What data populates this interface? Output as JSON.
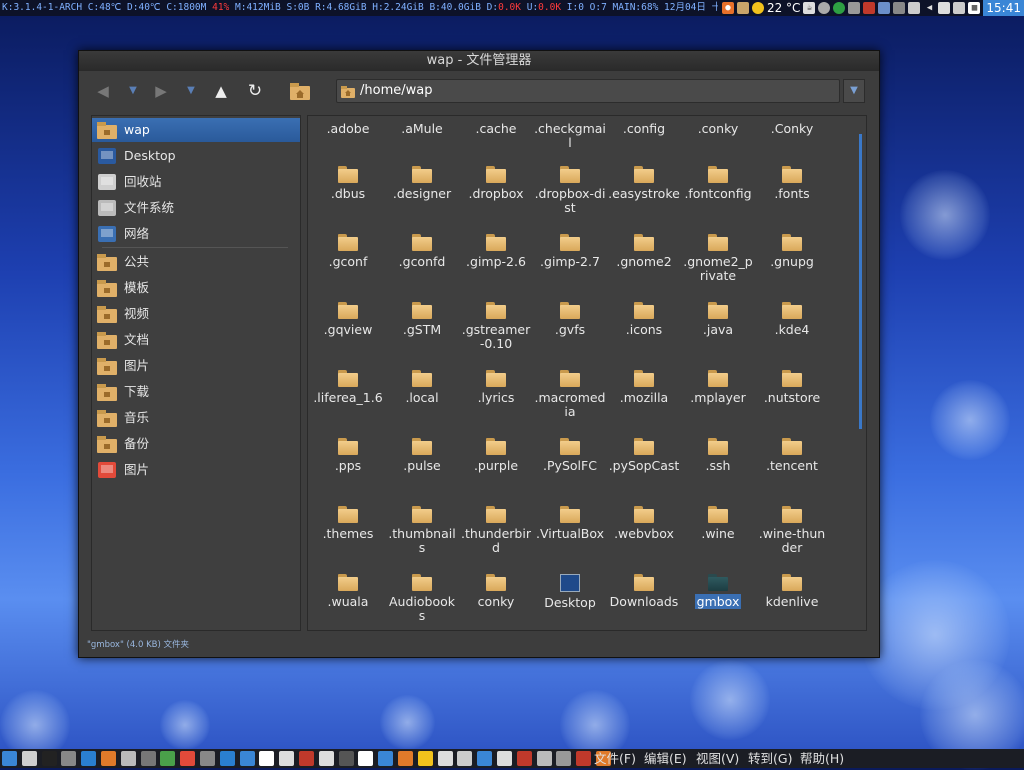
{
  "topbar": {
    "conky_1": "K:3.1.4-1-ARCH C:48℃ D:40℃ C:1800M",
    "conky_red1": "41%",
    "conky_2": " M:412MiB S:0B R:4.68GiB H:2.24GiB B:40.0GiB D:",
    "conky_red2": "0.0K",
    "conky_3": " U:",
    "conky_red3": "0.0K",
    "conky_4": " I:0 O:7   MAIN:68% 12月04日 十一月初十",
    "weather": "22 °C",
    "clock": "15:41"
  },
  "window": {
    "title": "wap - 文件管理器",
    "location": "/home/wap",
    "status": "\"gmbox\" (4.0 KB) 文件夹"
  },
  "sidebar": {
    "items": [
      {
        "label": "wap",
        "icon": "home-folder-icon"
      },
      {
        "label": "Desktop",
        "icon": "desktop-icon"
      },
      {
        "label": "回收站",
        "icon": "trash-icon"
      },
      {
        "label": "文件系统",
        "icon": "drive-icon"
      },
      {
        "label": "网络",
        "icon": "network-icon"
      },
      {
        "label": "公共",
        "icon": "public-folder-icon"
      },
      {
        "label": "模板",
        "icon": "templates-folder-icon"
      },
      {
        "label": "视频",
        "icon": "videos-folder-icon"
      },
      {
        "label": "文档",
        "icon": "documents-folder-icon"
      },
      {
        "label": "图片",
        "icon": "pictures-folder-icon"
      },
      {
        "label": "下载",
        "icon": "downloads-folder-icon"
      },
      {
        "label": "音乐",
        "icon": "music-folder-icon"
      },
      {
        "label": "备份",
        "icon": "backup-folder-icon"
      },
      {
        "label": "图片",
        "icon": "image-viewer-icon"
      }
    ]
  },
  "files": [
    {
      "label": ".adobe"
    },
    {
      "label": ".aMule"
    },
    {
      "label": ".cache"
    },
    {
      "label": ".checkgmail"
    },
    {
      "label": ".config"
    },
    {
      "label": ".conky"
    },
    {
      "label": ".Conky"
    },
    {
      "label": ".dbus"
    },
    {
      "label": ".designer"
    },
    {
      "label": ".dropbox"
    },
    {
      "label": ".dropbox-dist"
    },
    {
      "label": ".easystroke"
    },
    {
      "label": ".fontconfig"
    },
    {
      "label": ".fonts"
    },
    {
      "label": ".gconf"
    },
    {
      "label": ".gconfd"
    },
    {
      "label": ".gimp-2.6"
    },
    {
      "label": ".gimp-2.7"
    },
    {
      "label": ".gnome2"
    },
    {
      "label": ".gnome2_private"
    },
    {
      "label": ".gnupg"
    },
    {
      "label": ".gqview"
    },
    {
      "label": ".gSTM"
    },
    {
      "label": ".gstreamer-0.10"
    },
    {
      "label": ".gvfs"
    },
    {
      "label": ".icons"
    },
    {
      "label": ".java"
    },
    {
      "label": ".kde4"
    },
    {
      "label": ".liferea_1.6"
    },
    {
      "label": ".local"
    },
    {
      "label": ".lyrics"
    },
    {
      "label": ".macromedia"
    },
    {
      "label": ".mozilla"
    },
    {
      "label": ".mplayer"
    },
    {
      "label": ".nutstore"
    },
    {
      "label": ".pps"
    },
    {
      "label": ".pulse"
    },
    {
      "label": ".purple"
    },
    {
      "label": ".PySolFC"
    },
    {
      "label": ".pySopCast"
    },
    {
      "label": ".ssh"
    },
    {
      "label": ".tencent"
    },
    {
      "label": ".themes"
    },
    {
      "label": ".thumbnails"
    },
    {
      "label": ".thunderbird"
    },
    {
      "label": ".VirtualBox"
    },
    {
      "label": ".webvbox"
    },
    {
      "label": ".wine"
    },
    {
      "label": ".wine-thunder"
    },
    {
      "label": ".wuala"
    },
    {
      "label": "Audiobooks"
    },
    {
      "label": "conky"
    },
    {
      "label": "Desktop"
    },
    {
      "label": "Downloads"
    },
    {
      "label": "gmbox"
    },
    {
      "label": "kdenlive"
    }
  ],
  "menu": {
    "file": "文件(F)",
    "edit": "编辑(E)",
    "view": "视图(V)",
    "go": "转到(G)",
    "help": "帮助(H)"
  },
  "colors": {
    "accent": "#3a6fb3",
    "folder": "#e6b86a",
    "clock_bg": "#3a86d6"
  }
}
